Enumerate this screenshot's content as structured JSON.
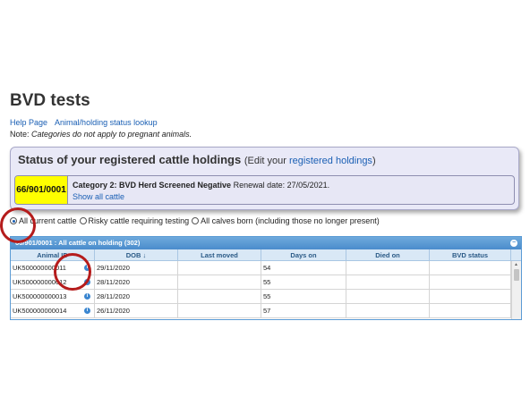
{
  "page": {
    "title": "BVD tests"
  },
  "links": {
    "help": "Help Page",
    "lookup": "Animal/holding status lookup"
  },
  "note": {
    "prefix": "Note:",
    "text": "Categories do not apply to pregnant animals."
  },
  "status_panel": {
    "heading": "Status of your registered cattle holdings",
    "edit_prefix": "(Edit your ",
    "edit_link": "registered holdings",
    "edit_suffix": ")",
    "holding": {
      "id": "66/901/0001",
      "category": "Category 2: BVD Herd Screened Negative",
      "renewal": "Renewal date: 27/05/2021.",
      "show_all": "Show all cattle",
      "highlight_color": "#ffff00"
    }
  },
  "filters": {
    "options": [
      {
        "label": "All current cattle",
        "checked": true
      },
      {
        "label": "Risky cattle requiring testing",
        "checked": false
      },
      {
        "label": "All calves born (including those no longer present)",
        "checked": false
      }
    ]
  },
  "grid": {
    "title": "66/901/0001 : All cattle on holding (302)",
    "collapse_icon": "minus-icon",
    "columns": [
      "Animal ID",
      "DOB",
      "Last moved",
      "Days on",
      "Died on",
      "BVD status"
    ],
    "sort_indicator": "↓",
    "rows": [
      {
        "animal_id": "UK500000000011",
        "dob": "29/11/2020",
        "last_moved": "",
        "days_on": "54",
        "died_on": "",
        "bvd_status": ""
      },
      {
        "animal_id": "UK500000000012",
        "dob": "28/11/2020",
        "last_moved": "",
        "days_on": "55",
        "died_on": "",
        "bvd_status": ""
      },
      {
        "animal_id": "UK500000000013",
        "dob": "28/11/2020",
        "last_moved": "",
        "days_on": "55",
        "died_on": "",
        "bvd_status": ""
      },
      {
        "animal_id": "UK500000000014",
        "dob": "26/11/2020",
        "last_moved": "",
        "days_on": "57",
        "died_on": "",
        "bvd_status": ""
      }
    ],
    "header_color": "#4a8ccc",
    "info_icon": "info-icon"
  },
  "annotation_color": "#b51c1c"
}
